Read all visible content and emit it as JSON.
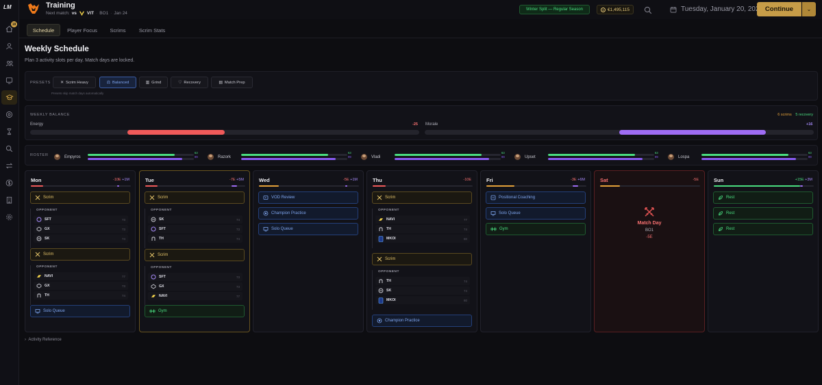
{
  "rail": {
    "logo": "LM",
    "badge": "18",
    "icons": [
      "home-icon",
      "user-icon",
      "team-icon",
      "inbox-icon",
      "training-icon",
      "scouting-icon",
      "trophy-icon",
      "search-icon",
      "transfer-icon",
      "finance-icon",
      "building-icon",
      "settings-icon"
    ]
  },
  "header": {
    "title": "Training",
    "next_match_label": "Next match:",
    "vs": "vs",
    "opponent": "VIT",
    "format": "BO1",
    "date_short": "Jan 24",
    "split": "Winter Split — Regular Season",
    "money": "€1,495,115",
    "date_full": "Tuesday, January 20, 2026",
    "continue": "Continue"
  },
  "tabs": [
    "Schedule",
    "Player Focus",
    "Scrims",
    "Scrim Stats"
  ],
  "page": {
    "title": "Weekly Schedule",
    "subtitle": "Plan 3 activity slots per day. Match days are locked."
  },
  "presets": {
    "label": "PRESETS",
    "options": [
      "Scrim Heavy",
      "Balanced",
      "Grind",
      "Recovery",
      "Match Prep"
    ],
    "selected": "Balanced",
    "note": "Presets skip match days automatically"
  },
  "balance": {
    "label": "WEEKLY BALANCE",
    "scrims": "6 scrims",
    "recovery": "5 recovery",
    "energy_label": "Energy",
    "energy_value": "-25",
    "energy_fraction": 0.25,
    "morale_label": "Morale",
    "morale_value": "+16",
    "morale_fraction": 0.4
  },
  "roster": {
    "label": "ROSTER",
    "players": [
      {
        "name": "Empyros",
        "v1": "63",
        "v2": "99",
        "f1": 0.63,
        "f2": 0.99
      },
      {
        "name": "Razork",
        "v1": "63",
        "v2": "99",
        "f1": 0.63,
        "f2": 0.99
      },
      {
        "name": "Vladi",
        "v1": "63",
        "v2": "99",
        "f1": 0.63,
        "f2": 0.99
      },
      {
        "name": "Upset",
        "v1": "63",
        "v2": "99",
        "f1": 0.63,
        "f2": 0.99
      },
      {
        "name": "Lospa",
        "v1": "63",
        "v2": "99",
        "f1": 0.63,
        "f2": 0.99
      }
    ]
  },
  "opponent_label": "OPPONENT",
  "days": [
    {
      "name": "Mon",
      "energy": "-10E",
      "morale": "+1M"
    },
    {
      "name": "Tue",
      "energy": "-7E",
      "morale": "+5M"
    },
    {
      "name": "Wed",
      "energy": "-5E",
      "morale": "+1M"
    },
    {
      "name": "Thu",
      "energy": "-10E",
      "morale": ""
    },
    {
      "name": "Fri",
      "energy": "-3E",
      "morale": "+6M"
    },
    {
      "name": "Sat",
      "energy": "-5E",
      "morale": ""
    },
    {
      "name": "Sun",
      "energy": "+15E",
      "morale": "+3M"
    }
  ],
  "slots": {
    "scrim": "Scrim",
    "solo_queue": "Solo Queue",
    "gym": "Gym",
    "vod_review": "VOD Review",
    "champion_practice": "Champion Practice",
    "positional_coaching": "Positional Coaching",
    "rest": "Rest"
  },
  "opponents": {
    "mon1": [
      {
        "t": "SFT",
        "s": "73"
      },
      {
        "t": "GX",
        "s": "73"
      },
      {
        "t": "SK",
        "s": "74"
      }
    ],
    "mon2": [
      {
        "t": "NAVI",
        "s": "77"
      },
      {
        "t": "GX",
        "s": "73"
      },
      {
        "t": "TH",
        "s": "74"
      }
    ],
    "tue1": [
      {
        "t": "SK",
        "s": "74"
      },
      {
        "t": "SFT",
        "s": "73"
      },
      {
        "t": "TH",
        "s": "74"
      }
    ],
    "tue2": [
      {
        "t": "SFT",
        "s": "73"
      },
      {
        "t": "GX",
        "s": "73"
      },
      {
        "t": "NAVI",
        "s": "77"
      }
    ],
    "thu1": [
      {
        "t": "NAVI",
        "s": "77"
      },
      {
        "t": "TH",
        "s": "74"
      },
      {
        "t": "MKOI",
        "s": "80"
      }
    ],
    "thu2": [
      {
        "t": "TH",
        "s": "74"
      },
      {
        "t": "SK",
        "s": "74"
      },
      {
        "t": "MKOI",
        "s": "80"
      }
    ]
  },
  "saturday": {
    "title": "Match Day",
    "format": "BO1",
    "energy": "-5E"
  },
  "activity_reference": "Activity Reference",
  "colors": {
    "accent": "#c69c48",
    "energy": "#f87171",
    "morale": "#8b5cf6",
    "green": "#4ade80",
    "blue": "#7fa6f0"
  }
}
